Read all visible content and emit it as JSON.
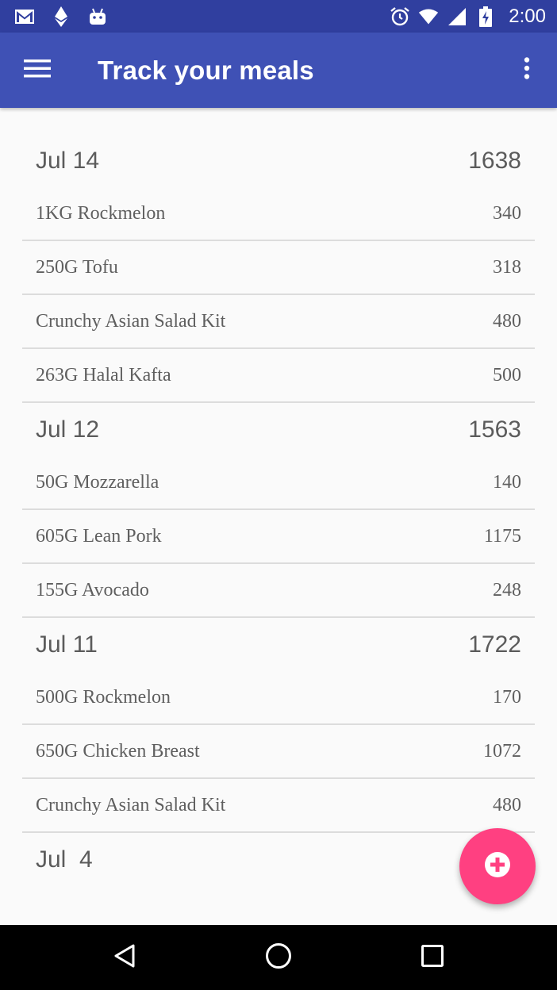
{
  "status_bar": {
    "time": "2:00",
    "left_icons": [
      "gmail-icon",
      "ethereum-icon",
      "android-icon"
    ],
    "right_icons": [
      "alarm-icon",
      "wifi-icon",
      "signal-icon",
      "battery-charging-icon"
    ]
  },
  "app_bar": {
    "title": "Track your meals",
    "menu_icon": "hamburger-menu-icon",
    "overflow_icon": "more-vert-icon"
  },
  "days": [
    {
      "date": "Jul 14",
      "total": "1638",
      "meals": [
        {
          "name": "1KG Rockmelon",
          "calories": "340"
        },
        {
          "name": "250G Tofu",
          "calories": "318"
        },
        {
          "name": "Crunchy Asian Salad Kit",
          "calories": "480"
        },
        {
          "name": "263G Halal Kafta",
          "calories": "500"
        }
      ]
    },
    {
      "date": "Jul 12",
      "total": "1563",
      "meals": [
        {
          "name": "50G Mozzarella",
          "calories": "140"
        },
        {
          "name": "605G Lean Pork",
          "calories": "1175"
        },
        {
          "name": "155G Avocado",
          "calories": "248"
        }
      ]
    },
    {
      "date": "Jul 11",
      "total": "1722",
      "meals": [
        {
          "name": "500G Rockmelon",
          "calories": "170"
        },
        {
          "name": "650G Chicken Breast",
          "calories": "1072"
        },
        {
          "name": "Crunchy Asian Salad Kit",
          "calories": "480"
        }
      ]
    },
    {
      "date": "Jul  4",
      "total": "",
      "meals": []
    }
  ],
  "fab": {
    "icon": "add-circle-icon"
  },
  "nav_bar": {
    "icons": [
      "back-icon",
      "home-icon",
      "recents-icon"
    ]
  },
  "colors": {
    "primary_dark": "#303f9f",
    "primary": "#3f51b5",
    "accent": "#ff4081"
  }
}
